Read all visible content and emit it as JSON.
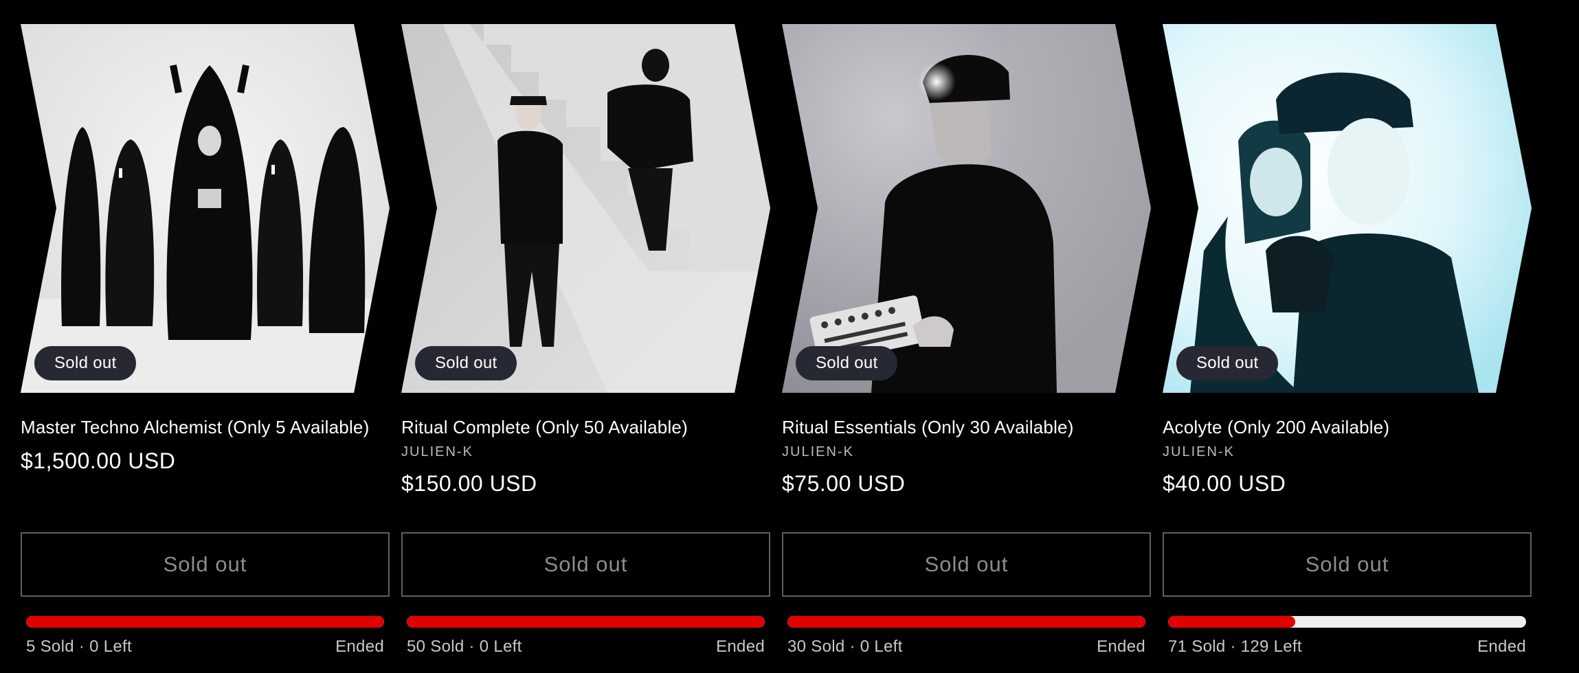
{
  "products": [
    {
      "badge": "Sold out",
      "title": "Master Techno Alchemist (Only 5 Available)",
      "vendor": "",
      "price": "$1,500.00 USD",
      "button": "Sold out",
      "sold_text": "5 Sold · 0 Left",
      "status": "Ended",
      "progress_fraction": 1.0,
      "image": "photo-hooded-figures"
    },
    {
      "badge": "Sold out",
      "title": "Ritual Complete (Only 50 Available)",
      "vendor": "JULIEN-K",
      "price": "$150.00 USD",
      "button": "Sold out",
      "sold_text": "50 Sold · 0 Left",
      "status": "Ended",
      "progress_fraction": 1.0,
      "image": "photo-staircase-duo"
    },
    {
      "badge": "Sold out",
      "title": "Ritual Essentials (Only 30 Available)",
      "vendor": "JULIEN-K",
      "price": "$75.00 USD",
      "button": "Sold out",
      "sold_text": "30 Sold · 0 Left",
      "status": "Ended",
      "progress_fraction": 1.0,
      "image": "photo-cap-synth"
    },
    {
      "badge": "Sold out",
      "title": "Acolyte (Only 200 Available)",
      "vendor": "JULIEN-K",
      "price": "$40.00 USD",
      "button": "Sold out",
      "sold_text": "71 Sold · 129 Left",
      "status": "Ended",
      "progress_fraction": 0.355,
      "image": "photo-cyan-duo"
    }
  ],
  "colors": {
    "background": "#000000",
    "badge": "#262833",
    "progress_fill": "#e00000",
    "progress_track": "#efefef",
    "button_border": "#5f5f5f"
  }
}
